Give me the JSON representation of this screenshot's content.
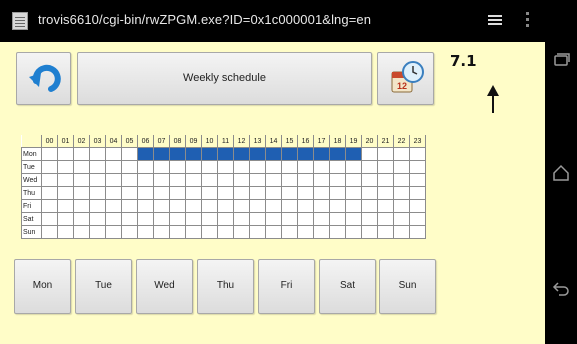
{
  "browser": {
    "url": "trovis6610/cgi-bin/rwZPGM.exe?ID=0x1c000001&lng=en"
  },
  "toolbar": {
    "title": "Weekly schedule",
    "back_icon": "back-arrow-icon",
    "clock_icon": "calendar-clock-icon",
    "calendar_badge": "12"
  },
  "callout": {
    "label": "7.1"
  },
  "schedule": {
    "hours": [
      "00",
      "01",
      "02",
      "03",
      "04",
      "05",
      "06",
      "07",
      "08",
      "09",
      "10",
      "11",
      "12",
      "13",
      "14",
      "15",
      "16",
      "17",
      "18",
      "19",
      "20",
      "21",
      "22",
      "23"
    ],
    "days": [
      {
        "label": "Mon",
        "active": [
          6,
          7,
          8,
          9,
          10,
          11,
          12,
          13,
          14,
          15,
          16,
          17,
          18,
          19
        ]
      },
      {
        "label": "Tue",
        "active": []
      },
      {
        "label": "Wed",
        "active": []
      },
      {
        "label": "Thu",
        "active": []
      },
      {
        "label": "Fri",
        "active": []
      },
      {
        "label": "Sat",
        "active": []
      },
      {
        "label": "Sun",
        "active": []
      }
    ],
    "active_color": "#1f5fb2"
  },
  "day_buttons": [
    "Mon",
    "Tue",
    "Wed",
    "Thu",
    "Fri",
    "Sat",
    "Sun"
  ]
}
